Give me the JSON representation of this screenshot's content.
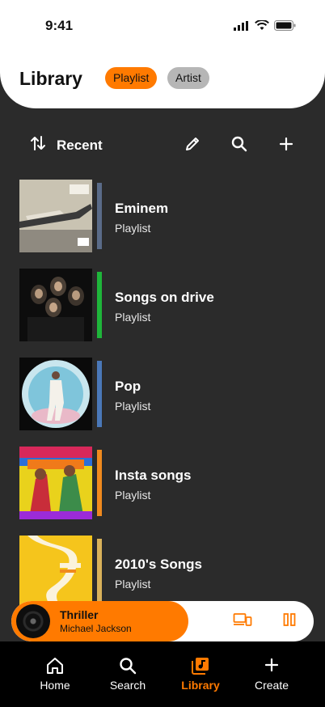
{
  "status_bar": {
    "time": "9:41"
  },
  "header": {
    "title": "Library",
    "chips": [
      {
        "label": "Playlist",
        "active": true
      },
      {
        "label": "Artist",
        "active": false
      }
    ]
  },
  "toolbar": {
    "sort_label": "Recent",
    "icons": [
      "sort-icon",
      "pencil-icon",
      "search-icon",
      "plus-icon"
    ]
  },
  "items": [
    {
      "title": "Eminem",
      "subtitle": "Playlist",
      "stripe": "#5a6b88"
    },
    {
      "title": "Songs on drive",
      "subtitle": "Playlist",
      "stripe": "#1eb53a"
    },
    {
      "title": "Pop",
      "subtitle": "Playlist",
      "stripe": "#4a78b8"
    },
    {
      "title": "Insta songs",
      "subtitle": "Playlist",
      "stripe": "#f08a1e"
    },
    {
      "title": "2010's Songs",
      "subtitle": "Playlist",
      "stripe": "#d9b25a"
    }
  ],
  "mini_player": {
    "title": "Thriller",
    "artist": "Michael Jackson",
    "accent": "#ff7a00"
  },
  "nav": [
    {
      "label": "Home",
      "icon": "home-icon",
      "active": false
    },
    {
      "label": "Search",
      "icon": "search-icon",
      "active": false
    },
    {
      "label": "Library",
      "icon": "library-icon",
      "active": true
    },
    {
      "label": "Create",
      "icon": "plus-icon",
      "active": false
    }
  ],
  "colors": {
    "accent": "#ff7a00",
    "background": "#2b2b2b",
    "nav_bg": "#000000"
  }
}
